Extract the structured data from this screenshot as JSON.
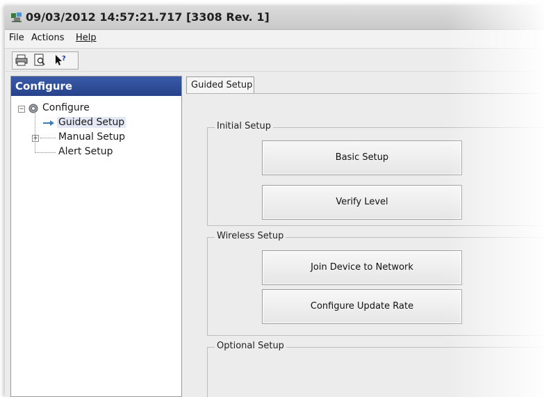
{
  "window": {
    "title": "09/03/2012 14:57:21.717 [3308 Rev. 1]",
    "app_icon": "app-logo-icon"
  },
  "menu": {
    "items": [
      "File",
      "Actions",
      "Help"
    ]
  },
  "toolbar": {
    "buttons": [
      {
        "icon": "printer-icon"
      },
      {
        "icon": "print-preview-icon"
      },
      {
        "icon": "whats-this-help-icon"
      }
    ]
  },
  "left_panel": {
    "header": "Configure",
    "tree": {
      "root": "Configure",
      "items": [
        "Guided Setup",
        "Manual Setup",
        "Alert Setup"
      ]
    }
  },
  "tab": {
    "label": "Guided Setup"
  },
  "sections": {
    "initial": {
      "title": "Initial Setup",
      "buttons": [
        "Basic Setup",
        "Verify Level"
      ]
    },
    "wireless": {
      "title": "Wireless Setup",
      "buttons": [
        "Join Device to Network",
        "Configure Update Rate"
      ]
    },
    "optional": {
      "title": "Optional Setup"
    }
  },
  "colors": {
    "panel_header": "#2f4e98",
    "window_bg": "#ececec"
  }
}
